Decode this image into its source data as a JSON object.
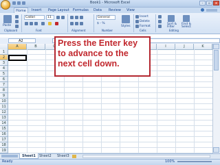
{
  "window": {
    "title": "Book1 - Microsoft Excel",
    "minimize": "–",
    "restore": "▫",
    "close": "x"
  },
  "tabs": [
    "Home",
    "Insert",
    "Page Layout",
    "Formulas",
    "Data",
    "Review",
    "View"
  ],
  "ribbon": {
    "paste_label": "Paste",
    "font_name": "Calibri",
    "font_size": "11",
    "number_format": "General",
    "currency_label": "$ - %",
    "styles_label": "Styles",
    "insert_label": "Insert",
    "delete_label": "Delete",
    "format_label": "Format",
    "sort_label": "Sort &",
    "filter_label": "Filter",
    "find_label": "Find &",
    "select_label": "Select",
    "groups": [
      "Clipboard",
      "Font",
      "Alignment",
      "Number",
      "Cells",
      "Editing"
    ]
  },
  "formula_bar": {
    "name_box": "A2",
    "formula": ""
  },
  "columns": [
    "A",
    "B",
    "C",
    "D",
    "E",
    "F",
    "G",
    "H",
    "I",
    "J",
    "K"
  ],
  "rows": [
    "1",
    "2",
    "3",
    "4",
    "5",
    "6",
    "7",
    "8",
    "9",
    "10",
    "11",
    "12",
    "13",
    "14",
    "15",
    "16",
    "17",
    "18",
    "19"
  ],
  "selected_cell": "A2",
  "sheets": [
    "Sheet1",
    "Sheet2",
    "Sheet3"
  ],
  "status": {
    "mode": "Ready",
    "zoom": "100%"
  },
  "callout": {
    "line1": "Press the Enter key",
    "line2": "to advance to the",
    "line3": "next cell down."
  },
  "colors": {
    "callout_text": "#c1272d",
    "callout_border": "#b3262f",
    "ribbon": "#d3e2f4"
  }
}
